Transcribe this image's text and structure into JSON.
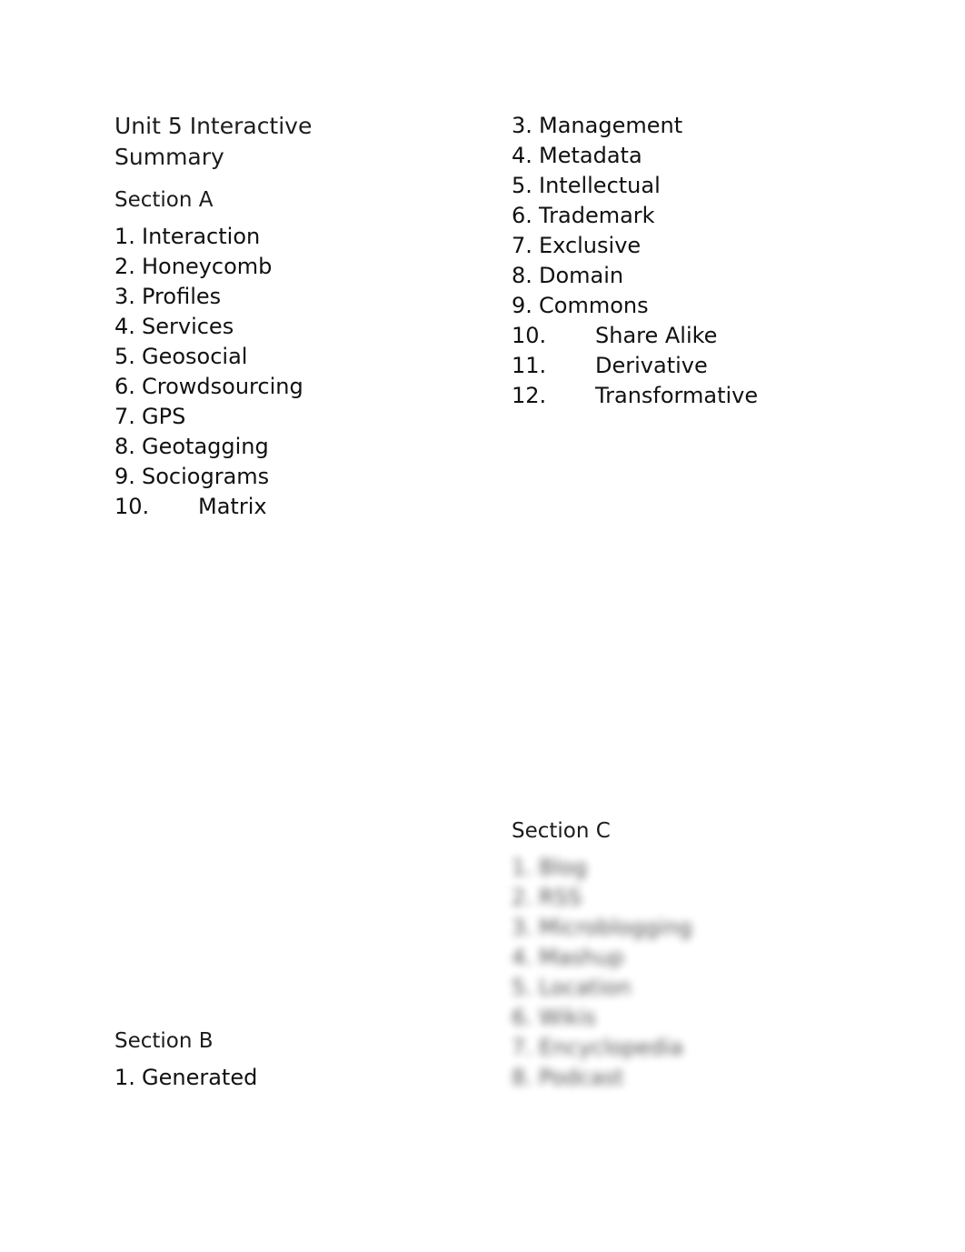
{
  "document": {
    "title": "Unit 5 Interactive Summary"
  },
  "section_a": {
    "heading": "Section A",
    "items": [
      {
        "num": "1.",
        "text": "Interaction"
      },
      {
        "num": "2.",
        "text": "Honeycomb"
      },
      {
        "num": "3.",
        "text": "Profiles"
      },
      {
        "num": "4.",
        "text": "Services"
      },
      {
        "num": "5.",
        "text": "Geosocial"
      },
      {
        "num": "6.",
        "text": "Crowdsourcing"
      },
      {
        "num": "7.",
        "text": "GPS"
      },
      {
        "num": "8.",
        "text": "Geotagging"
      },
      {
        "num": "9.",
        "text": "Sociograms"
      },
      {
        "num": "10.",
        "text": "Matrix"
      }
    ]
  },
  "section_a_continued": {
    "items": [
      {
        "num": "3.",
        "text": "Management"
      },
      {
        "num": "4.",
        "text": "Metadata"
      },
      {
        "num": "5.",
        "text": "Intellectual"
      },
      {
        "num": "6.",
        "text": "Trademark"
      },
      {
        "num": "7.",
        "text": "Exclusive"
      },
      {
        "num": "8.",
        "text": "Domain"
      },
      {
        "num": "9.",
        "text": "Commons"
      },
      {
        "num": "10.",
        "text": "Share Alike"
      },
      {
        "num": "11.",
        "text": "Derivative"
      },
      {
        "num": "12.",
        "text": "Transformative"
      }
    ]
  },
  "section_b": {
    "heading": "Section B",
    "items": [
      {
        "num": "1.",
        "text": "Generated"
      }
    ]
  },
  "section_c": {
    "heading": "Section C",
    "items": [
      {
        "num": "1.",
        "text": "Blog"
      },
      {
        "num": "2.",
        "text": "RSS"
      },
      {
        "num": "3.",
        "text": "Microblogging"
      },
      {
        "num": "4.",
        "text": "Mashup"
      },
      {
        "num": "5.",
        "text": "Location"
      },
      {
        "num": "6.",
        "text": "Wikis"
      },
      {
        "num": "7.",
        "text": "Encyclopedia"
      },
      {
        "num": "8.",
        "text": "Podcast"
      }
    ]
  }
}
